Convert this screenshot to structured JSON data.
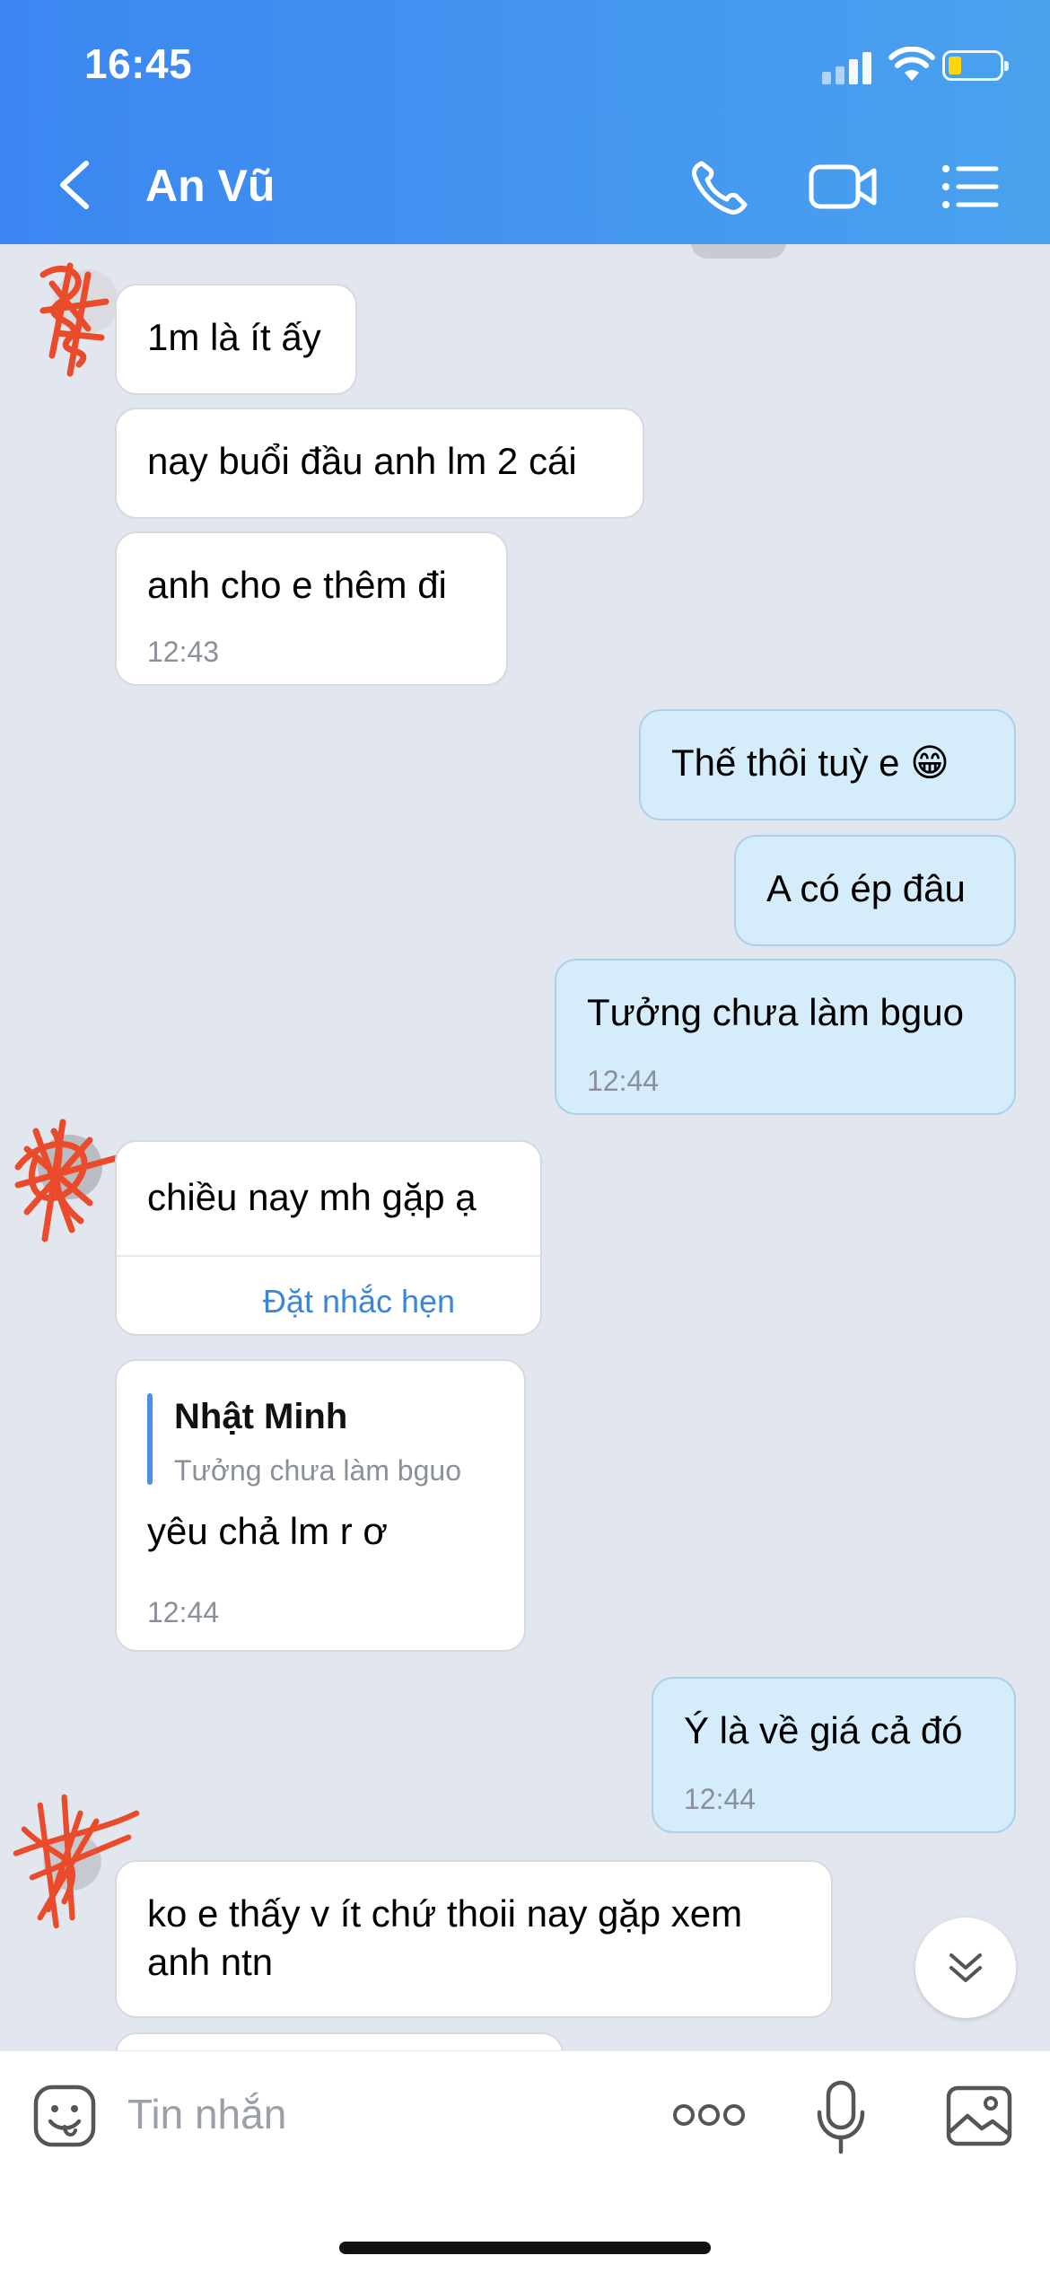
{
  "status_bar": {
    "time": "16:45"
  },
  "header": {
    "title": "An Vũ"
  },
  "messages": [
    {
      "text": "1m là ít ấy"
    },
    {
      "text": "nay buổi đầu anh lm 2 cái"
    },
    {
      "text": "anh cho e thêm đi",
      "time": "12:43"
    },
    {
      "text": "Thế thôi tuỳ e 😁"
    },
    {
      "text": "A có ép đâu"
    },
    {
      "text": "Tưởng chưa làm bguo",
      "time": "12:44"
    },
    {
      "text": "chiều nay mh gặp ạ",
      "action": "Đặt nhắc hẹn"
    },
    {
      "quote_name": "Nhật Minh",
      "quote_text": "Tưởng chưa làm bguo",
      "text": "yêu chả lm r ơ",
      "time": "12:44"
    },
    {
      "text": "Ý là về giá cả đó",
      "time": "12:44"
    },
    {
      "line1": "ko e thấy v ít chứ thoii nay gặp xem",
      "line2": "anh ntn"
    }
  ],
  "composer": {
    "placeholder": "Tin nhắn"
  },
  "colors": {
    "header_start": "#3b86f1",
    "header_end": "#4aa2ee",
    "outgoing_bubble": "#d5ecfb",
    "chat_background": "#e2e6ef",
    "link": "#3a86d8"
  }
}
